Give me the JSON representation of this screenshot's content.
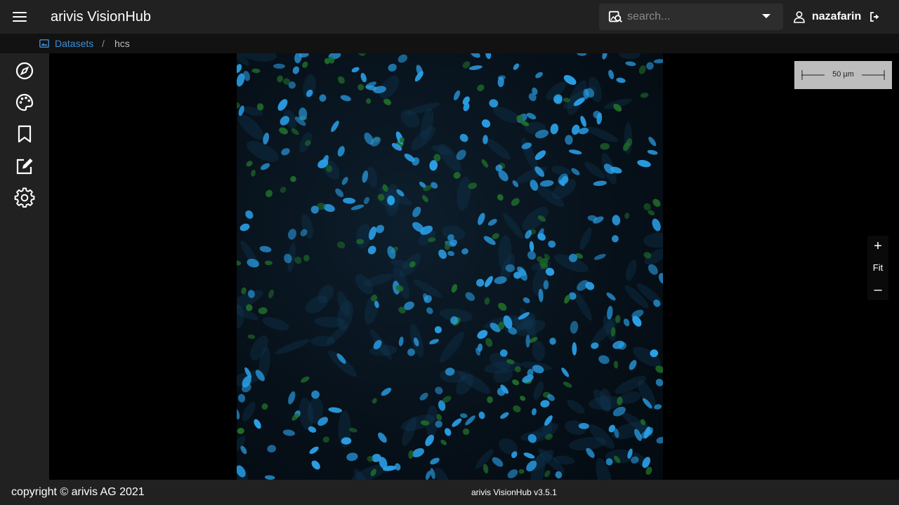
{
  "header": {
    "app_title": "arivis VisionHub",
    "menu_icon": "hamburger-menu-icon",
    "search": {
      "placeholder": "search...",
      "value": "",
      "icon": "image-search-icon"
    },
    "user": {
      "name": "nazafarin",
      "icon": "user-icon",
      "logout_icon": "logout-icon"
    }
  },
  "breadcrumb": {
    "icon": "image-icon",
    "link": "Datasets",
    "separator": "/",
    "current": "hcs"
  },
  "sidebar": {
    "items": [
      {
        "name": "explore",
        "icon": "compass-icon"
      },
      {
        "name": "display",
        "icon": "palette-icon"
      },
      {
        "name": "bookmarks",
        "icon": "bookmark-icon"
      },
      {
        "name": "annotations",
        "icon": "edit-icon"
      },
      {
        "name": "settings",
        "icon": "gear-icon"
      }
    ],
    "expand_icon": "chevron-right-icon"
  },
  "viewer": {
    "scalebar_label": "50 µm",
    "zoom": {
      "in": "+",
      "fit": "Fit",
      "out": "–"
    }
  },
  "footer": {
    "copyright": "copyright © arivis AG 2021",
    "version": "arivis VisionHub v3.5.1"
  },
  "colors": {
    "accent": "#3d8fd6",
    "bar_bg": "#212121",
    "nucleus_blue": "#2a9fe6",
    "marker_green": "#1f6b2a"
  }
}
